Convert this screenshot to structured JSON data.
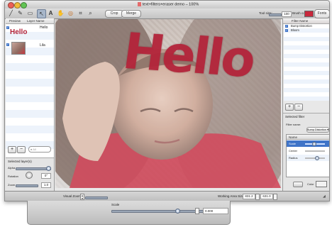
{
  "window": {
    "title": "text+filters+eraser demo – 100%"
  },
  "toolbar": {
    "crop_label": "Crop",
    "merge_label": "Merge",
    "tool_size_label": "Tool size:",
    "tool_size_value": "100",
    "brush_color_label": "Brush color:",
    "fonts_label": "Fonts",
    "tools": [
      "brush-icon",
      "pencil-icon",
      "eraser-icon",
      "arrow-icon",
      "text-icon",
      "hand-icon",
      "circle-target-icon",
      "crop-icon",
      "magnifier-icon"
    ]
  },
  "layers": {
    "col_preview": "Preview",
    "col_name": "Layer Name",
    "items": [
      {
        "preview_text": "Hello",
        "name": "Hello",
        "checked": true
      },
      {
        "preview_text": "",
        "name": "Lila",
        "checked": true
      }
    ],
    "search_placeholder": "All"
  },
  "selected_layers": {
    "heading": "Selected layer(s)",
    "opacity_label": "Alpha",
    "rotation_label": "Rotation",
    "rotation_value": "0°",
    "zoom_label": "Zoom",
    "zoom_value": "1.0"
  },
  "canvas": {
    "overlay_text": "Hello"
  },
  "filters": {
    "col_filter_name": "Filter Name",
    "items": [
      {
        "name": "Bump Distortion",
        "checked": true
      },
      {
        "name": "Bloom",
        "checked": true
      }
    ],
    "selected_heading": "Selected filter",
    "filter_name_label": "Filter name:",
    "filter_name_value": "Bump Distortion",
    "params_header": "Name",
    "params": [
      "Scale",
      "Center",
      "Radius"
    ],
    "color_label": "Color"
  },
  "status": {
    "visual_zoom_label": "Visual Zoom:",
    "working_area_label": "Working Area Size:",
    "width": "831.2",
    "height": "631.0"
  },
  "drawer": {
    "scale_label": "Scale",
    "scale_value": "0.000"
  },
  "colors": {
    "text_red": "#b3243a",
    "selection_blue": "#3f74c8",
    "brush_color": "#c8283c"
  }
}
